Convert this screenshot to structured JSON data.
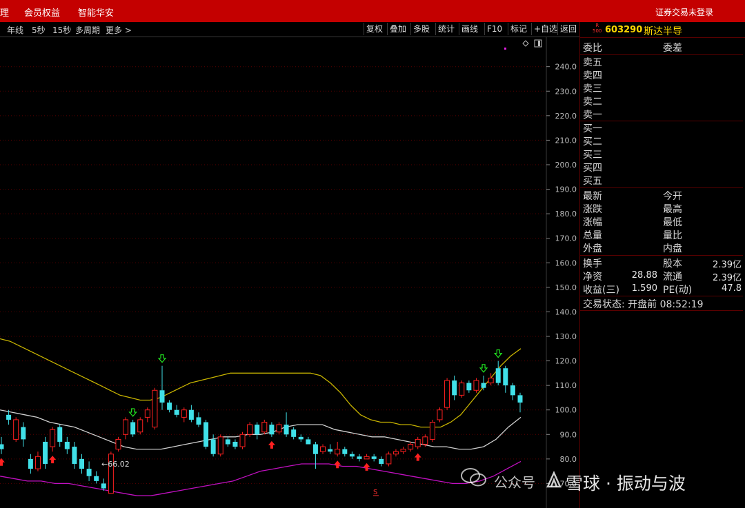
{
  "topbar": {
    "items": [
      "理",
      "会员权益",
      "智能华安"
    ],
    "login_status": "证券交易未登录"
  },
  "toolbar": {
    "periods": [
      "年线",
      "5秒",
      "15秒",
      "多周期",
      "更多 >"
    ],
    "buttons": [
      "复权",
      "叠加",
      "多股",
      "统计",
      "画线",
      "F10",
      "标记",
      "+自选",
      "返回"
    ]
  },
  "stock": {
    "badge": "R\n500",
    "code": "603290",
    "name": "斯达半导"
  },
  "order_book": {
    "header": [
      "委比",
      "委差"
    ],
    "sell": [
      "卖五",
      "卖四",
      "卖三",
      "卖二",
      "卖一"
    ],
    "buy": [
      "买一",
      "买二",
      "买三",
      "买四",
      "买五"
    ]
  },
  "quote": {
    "left": [
      "最新",
      "涨跌",
      "涨幅",
      "总量",
      "外盘"
    ],
    "right": [
      "今开",
      "最高",
      "最低",
      "量比",
      "内盘"
    ]
  },
  "fundamentals": [
    {
      "l1": "换手",
      "l2": "股本",
      "v2": "2.39亿"
    },
    {
      "l1": "净资",
      "v1": "28.88",
      "l2": "流通",
      "v2": "2.39亿"
    },
    {
      "l1": "收益(三)",
      "v1": "1.590",
      "l2": "PE(动)",
      "v2": "47.8"
    }
  ],
  "trade_status": "交易状态: 开盘前 08:52:19",
  "chart_data": {
    "type": "candlestick",
    "yticks": [
      70.0,
      80.0,
      90.0,
      100.0,
      110.0,
      120.0,
      130.0,
      140.0,
      150.0,
      160.0,
      170.0,
      180.0,
      190.0,
      200.0,
      210.0,
      220.0,
      230.0,
      240.0
    ],
    "ylim": [
      60,
      252
    ],
    "low_label": "←66.02",
    "colors": {
      "up": "#ff2020",
      "down": "#40e0e8",
      "upper": "#c8b400",
      "mid": "#d0d0d0",
      "lower": "#c010c0"
    },
    "candles": [
      [
        86,
        84,
        89,
        82
      ],
      [
        98,
        96,
        100,
        94
      ],
      [
        88,
        96,
        97,
        87
      ],
      [
        93,
        88,
        95,
        85
      ],
      [
        80,
        76,
        82,
        74
      ],
      [
        76,
        81,
        83,
        75
      ],
      [
        87,
        78,
        89,
        76
      ],
      [
        85,
        92,
        93,
        83
      ],
      [
        93,
        87,
        94,
        85
      ],
      [
        87,
        84,
        89,
        82
      ],
      [
        85,
        78,
        87,
        76
      ],
      [
        80,
        76,
        82,
        74
      ],
      [
        76,
        73,
        79,
        71
      ],
      [
        73,
        71,
        75,
        70
      ],
      [
        70,
        68,
        72,
        67
      ],
      [
        66,
        82,
        83,
        66
      ],
      [
        84,
        88,
        89,
        83
      ],
      [
        90,
        96,
        97,
        88
      ],
      [
        95,
        90,
        96,
        89
      ],
      [
        91,
        96,
        97,
        90
      ],
      [
        97,
        100,
        101,
        95
      ],
      [
        93,
        108,
        109,
        92
      ],
      [
        108,
        103,
        118,
        100
      ],
      [
        103,
        100,
        104,
        99
      ],
      [
        100,
        98,
        102,
        97
      ],
      [
        97,
        100,
        101,
        95
      ],
      [
        100,
        96,
        102,
        95
      ],
      [
        97,
        94,
        99,
        93
      ],
      [
        95,
        85,
        96,
        84
      ],
      [
        88,
        82,
        90,
        81
      ],
      [
        82,
        89,
        90,
        81
      ],
      [
        88,
        86,
        89,
        85
      ],
      [
        87,
        85,
        88,
        84
      ],
      [
        85,
        90,
        91,
        84
      ],
      [
        90,
        94,
        95,
        89
      ],
      [
        94,
        90,
        95,
        88
      ],
      [
        91,
        95,
        96,
        90
      ],
      [
        94,
        90,
        95,
        89
      ],
      [
        91,
        94,
        95,
        90
      ],
      [
        94,
        90,
        99,
        89
      ],
      [
        92,
        89,
        93,
        88
      ],
      [
        89,
        88,
        90,
        87
      ],
      [
        88,
        86,
        89,
        86
      ],
      [
        86,
        82,
        87,
        76
      ],
      [
        83,
        85,
        86,
        82
      ],
      [
        84,
        83,
        86,
        82
      ],
      [
        82,
        84,
        87,
        81
      ],
      [
        84,
        82,
        85,
        81
      ],
      [
        82,
        81,
        83,
        80
      ],
      [
        81,
        80,
        82,
        79
      ],
      [
        80,
        81,
        82,
        80
      ],
      [
        81,
        80,
        82,
        79
      ],
      [
        80,
        78,
        81,
        77
      ],
      [
        78,
        82,
        83,
        77
      ],
      [
        82,
        83,
        84,
        81
      ],
      [
        83,
        84,
        85,
        82
      ],
      [
        84,
        86,
        87,
        83
      ],
      [
        85,
        88,
        89,
        84
      ],
      [
        86,
        89,
        90,
        85
      ],
      [
        88,
        95,
        96,
        87
      ],
      [
        96,
        100,
        101,
        95
      ],
      [
        101,
        112,
        113,
        100
      ],
      [
        112,
        106,
        114,
        104
      ],
      [
        106,
        111,
        112,
        105
      ],
      [
        111,
        108,
        112,
        107
      ],
      [
        108,
        112,
        113,
        107
      ],
      [
        111,
        109,
        114,
        108
      ],
      [
        111,
        113,
        115,
        110
      ],
      [
        117,
        111,
        120,
        110
      ],
      [
        117,
        110,
        118,
        107
      ],
      [
        110,
        106,
        111,
        104
      ],
      [
        106,
        103,
        107,
        99
      ]
    ],
    "upper_band": [
      129,
      128,
      126,
      124,
      122,
      120,
      118,
      116,
      114,
      112,
      110,
      108,
      106,
      105,
      104,
      104,
      105,
      107,
      109,
      111,
      112,
      113,
      114,
      115,
      115,
      115,
      115,
      115,
      115,
      115,
      115,
      115,
      114,
      111,
      107,
      102,
      98,
      96,
      95,
      95,
      94,
      94,
      93,
      93,
      93,
      95,
      98,
      103,
      108,
      113,
      118,
      122,
      125
    ],
    "middle_band": [
      100,
      99,
      98,
      97,
      95,
      94,
      93,
      91,
      89,
      87,
      85,
      84,
      84,
      84,
      85,
      86,
      87,
      88,
      89,
      89,
      90,
      90,
      91,
      93,
      94,
      94,
      94,
      92,
      91,
      90,
      89,
      89,
      88,
      87,
      86,
      85,
      85,
      84,
      84,
      85,
      88,
      93,
      97
    ],
    "lower_band": [
      73,
      72,
      71,
      71,
      70,
      70,
      69,
      68,
      67,
      66,
      65,
      65,
      66,
      67,
      68,
      69,
      70,
      71,
      73,
      75,
      76,
      77,
      78,
      78,
      78,
      77,
      77,
      76,
      75,
      74,
      73,
      72,
      71,
      70,
      70,
      71,
      73,
      76,
      79
    ],
    "markers": [
      {
        "i": 0,
        "dir": "up"
      },
      {
        "i": 7,
        "dir": "up"
      },
      {
        "i": 18,
        "dir": "down"
      },
      {
        "i": 22,
        "dir": "down"
      },
      {
        "i": 37,
        "dir": "up"
      },
      {
        "i": 46,
        "dir": "up"
      },
      {
        "i": 50,
        "dir": "up"
      },
      {
        "i": 57,
        "dir": "up"
      },
      {
        "i": 66,
        "dir": "down"
      },
      {
        "i": 68,
        "dir": "down"
      }
    ]
  },
  "watermark": {
    "left": "公众号",
    "right": "雪球 · 振动与波"
  }
}
